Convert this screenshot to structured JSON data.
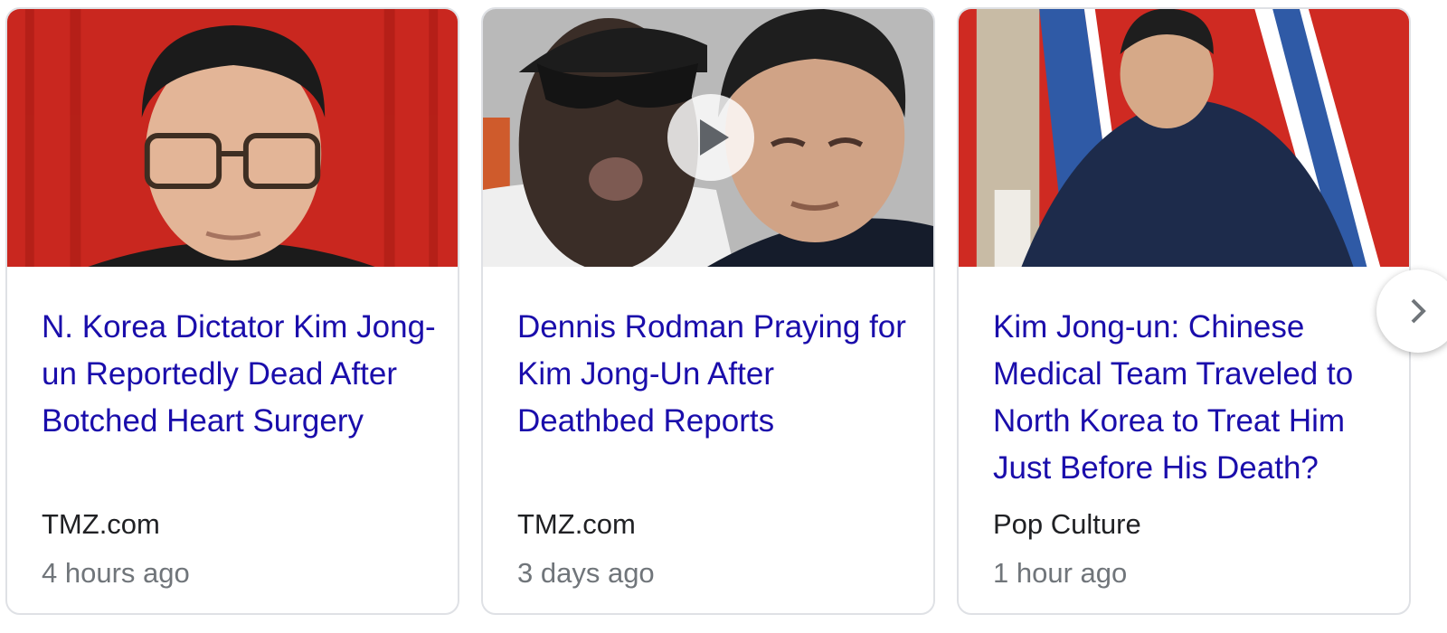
{
  "colors": {
    "title_link": "#1a0dab",
    "source_text": "#202124",
    "time_text": "#70757a",
    "card_border": "#dfe1e5"
  },
  "cards": [
    {
      "title": "N. Korea Dictator Kim Jong-un Reportedly Dead After Botched Heart Surgery",
      "source": "TMZ.com",
      "time": "4 hours ago",
      "thumbnail": "photo"
    },
    {
      "title": "Dennis Rodman Praying for Kim Jong-Un After Deathbed Reports",
      "source": "TMZ.com",
      "time": "3 days ago",
      "thumbnail": "video",
      "play_icon": "play-icon"
    },
    {
      "title": "Kim Jong-un: Chinese Medical Team Traveled to North Korea to Treat Him Just Before His Death?",
      "source": "Pop Culture",
      "time": "1 hour ago",
      "thumbnail": "photo"
    }
  ],
  "carousel": {
    "next_icon": "chevron-right-icon"
  }
}
